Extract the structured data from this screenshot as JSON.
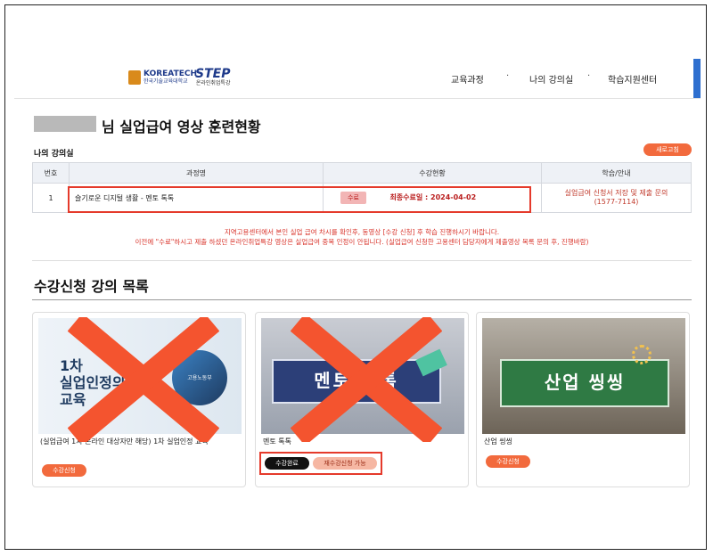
{
  "header": {
    "logo_korea_tech": "KOREATECH",
    "logo_korea_tech_sub": "한국기술교육대학교",
    "logo_step": "STEP",
    "logo_step_sub": "온라인취업특강",
    "nav": [
      "교육과정",
      "나의 강의실",
      "학습지원센터"
    ],
    "nav_sep": "·"
  },
  "page": {
    "title": "님 실업급여 영상 훈련현황",
    "my_classroom_label": "나의 강의실",
    "refresh_button": "새로고침"
  },
  "table": {
    "headers": [
      "번호",
      "과정명",
      "수강현황",
      "학습/안내"
    ],
    "rows": [
      {
        "no": "1",
        "course": "슬기로운 디지털 생활 - 멘토 톡톡",
        "status_badge": "수료",
        "final_completion": "최종수료일 : 2024-04-02",
        "guide_line1": "실업급여 신청서 저장 및 제출 문의",
        "guide_line2": "(1577-7114)"
      }
    ]
  },
  "notice": {
    "line1": "지역고용센터에서 본인 실업 급여 차시를 확인후, 동영상 [수강 신청] 후 학습 진행하시기 바랍니다.",
    "line2": "이전에 \"수료\"하시고 제출 하셨던 온라인취업특강 영상은 실업급여 중복 인정이 안됩니다. (실업급여 신청한 고용센터 담당자에게 제출영상 목록 문의 후, 진행바람)"
  },
  "section": {
    "title": "수강신청 강의 목록"
  },
  "cards": [
    {
      "thumb_line1": "1차",
      "thumb_line2": "실업인정의",
      "thumb_line3": "교육",
      "thumb_logo": "고용노동부",
      "title": "(실업급여 1차 온라인 대상자만 해당) 1차 실업인정 교육",
      "button": "수강신청"
    },
    {
      "thumb_text": "멘토 톡톡",
      "title": "멘토 톡톡",
      "button_done": "수강완료",
      "button_retake": "재수강신청 가능"
    },
    {
      "thumb_text": "산업 씽씽",
      "title": "산업 씽씽",
      "button": "수강신청"
    }
  ],
  "colors": {
    "accent_orange": "#f26a3d",
    "red_box": "#e53a2b",
    "x_mark": "#f4542f",
    "notice_red": "#d9342b",
    "brand_blue": "#1e3a8a"
  }
}
